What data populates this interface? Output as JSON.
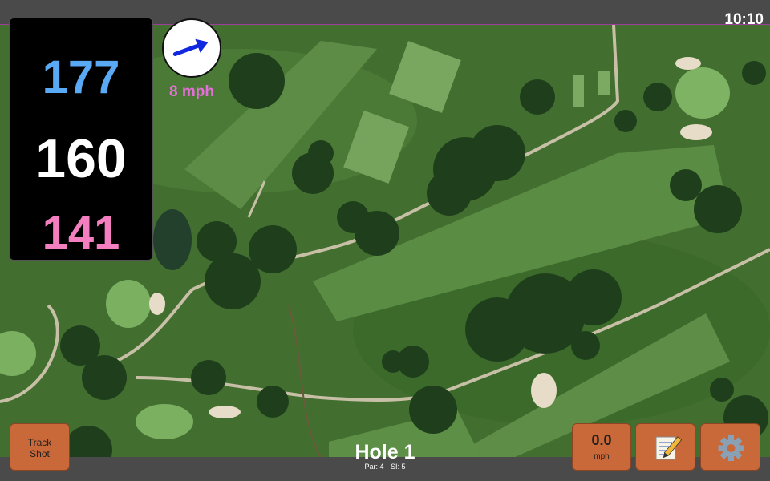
{
  "status_bar": {
    "time": "10:10"
  },
  "distances": {
    "back": "177",
    "middle": "160",
    "front": "141"
  },
  "wind": {
    "speed_label": "8 mph",
    "direction": "east-northeast",
    "arrow_color": "#1029e0"
  },
  "hole": {
    "title": "Hole 1",
    "par_label": "Par: 4",
    "si_label": "SI: 5"
  },
  "buttons": {
    "track_shot": {
      "line1": "Track",
      "line2": "Shot"
    },
    "speed": {
      "value": "0.0",
      "unit": "mph"
    },
    "notes_icon": "memo-icon",
    "settings_icon": "gear-icon"
  },
  "colors": {
    "back_distance": "#5aa9f5",
    "middle_distance": "#ffffff",
    "front_distance": "#f47fc0",
    "wind_label": "#e36fd7",
    "button": "#c96838"
  }
}
